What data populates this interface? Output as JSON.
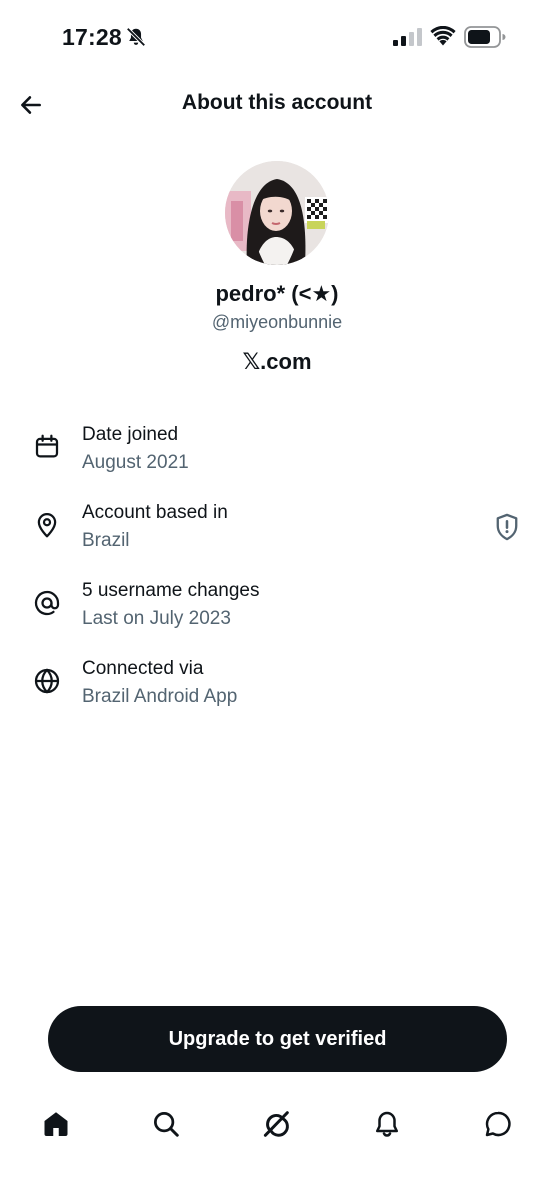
{
  "status_bar": {
    "time": "17:28",
    "icons": [
      "bell-off-icon",
      "signal-icon",
      "wifi-icon",
      "battery-icon"
    ]
  },
  "header": {
    "title": "About this account",
    "back_icon": "arrow-left-icon"
  },
  "profile": {
    "display_name": "pedro* (<★)",
    "handle": "@miyeonbunnie",
    "site": "𝕏.com"
  },
  "info": [
    {
      "icon": "calendar-icon",
      "label": "Date joined",
      "value": "August 2021"
    },
    {
      "icon": "location-pin-icon",
      "label": "Account based in",
      "value": "Brazil",
      "trailing_icon": "shield-alert-icon"
    },
    {
      "icon": "at-sign-icon",
      "label": "5 username changes",
      "value": "Last on July 2023"
    },
    {
      "icon": "globe-icon",
      "label": "Connected via",
      "value": "Brazil Android App"
    }
  ],
  "upgrade": {
    "label": "Upgrade to get verified"
  },
  "tab_bar": {
    "items": [
      "home-icon",
      "search-icon",
      "grok-icon",
      "notifications-icon",
      "messages-icon"
    ]
  },
  "colors": {
    "text": "#0f1419",
    "secondary": "#536471",
    "button": "#0f1419"
  }
}
